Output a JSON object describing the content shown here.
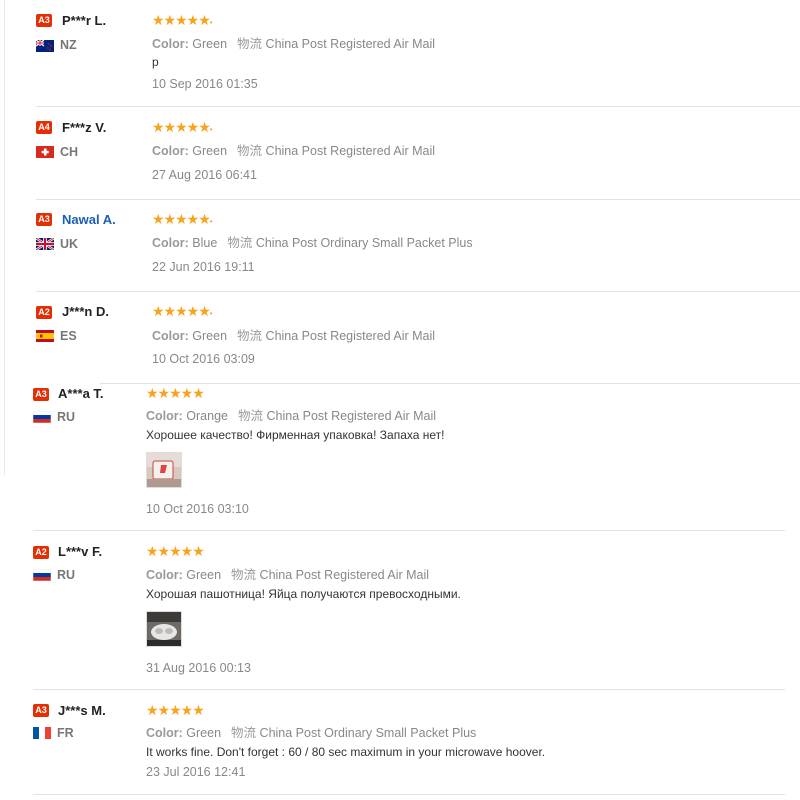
{
  "colors": {
    "level_badge": "#e62e04",
    "star": "#f7a31c",
    "link_name": "#1a5fb4"
  },
  "labels": {
    "color": "Color:",
    "shipping": "物流"
  },
  "reviews": [
    {
      "level": "A3",
      "name": "P***r L.",
      "country": "NZ",
      "flag": "nz-flag-icon",
      "color": "Green",
      "shipping": "China Post Registered Air Mail",
      "text": "p",
      "date": "10 Sep 2016 01:35",
      "stars": 5
    },
    {
      "level": "A4",
      "name": "F***z V.",
      "country": "CH",
      "flag": "ch-flag-icon",
      "color": "Green",
      "shipping": "China Post Registered Air Mail",
      "text": "",
      "date": "27 Aug 2016 06:41",
      "stars": 5
    },
    {
      "level": "A3",
      "name": "Nawal A.",
      "country": "UK",
      "flag": "uk-flag-icon",
      "color": "Blue",
      "shipping": "China Post Ordinary Small Packet Plus",
      "text": "",
      "date": "22 Jun 2016 19:11",
      "stars": 5
    },
    {
      "level": "A2",
      "name": "J***n D.",
      "country": "ES",
      "flag": "es-flag-icon",
      "color": "Green",
      "shipping": "China Post Registered Air Mail",
      "text": "",
      "date": "10 Oct 2016 03:09",
      "stars": 5
    },
    {
      "level": "A3",
      "name": "A***a T.",
      "country": "RU",
      "flag": "ru-flag-icon",
      "color": "Orange",
      "shipping": "China Post Registered Air Mail",
      "text": "Хорошее качество! Фирменная упаковка! Запаха нет!",
      "date": "10 Oct 2016 03:10",
      "stars": 5
    },
    {
      "level": "A2",
      "name": "L***v F.",
      "country": "RU",
      "flag": "ru-flag-icon",
      "color": "Green",
      "shipping": "China Post Registered Air Mail",
      "text": "Хорошая пашотница! Яйца получаются превосходными.",
      "date": "31 Aug 2016 00:13",
      "stars": 5
    },
    {
      "level": "A3",
      "name": "J***s M.",
      "country": "FR",
      "flag": "fr-flag-icon",
      "color": "Green",
      "shipping": "China Post Ordinary Small Packet Plus",
      "text": "It works fine. Don't forget : 60 / 80 sec maximum in your microwave hoover.",
      "date": "23 Jul 2016 12:41",
      "stars": 5
    }
  ]
}
